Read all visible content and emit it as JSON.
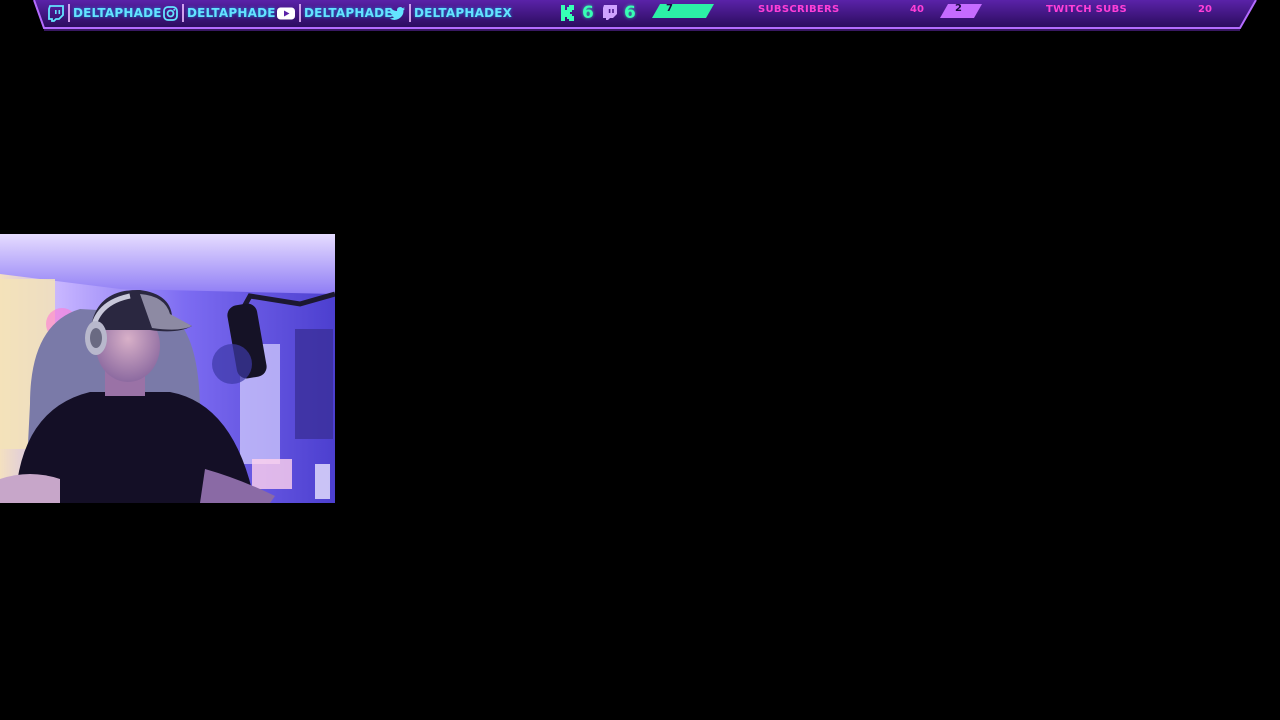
{
  "socials": [
    {
      "platform_icon": "twitch-icon",
      "handle": "DELTAPHADE"
    },
    {
      "platform_icon": "instagram-icon",
      "handle": "DELTAPHADE"
    },
    {
      "platform_icon": "youtube-icon",
      "handle": "DELTAPHADE"
    },
    {
      "platform_icon": "twitter-icon",
      "handle": "DELTAPHADEX"
    }
  ],
  "counters": {
    "kick": {
      "icon": "kick-icon",
      "value": "6"
    },
    "twitch": {
      "icon": "twitch-icon",
      "value": "6"
    }
  },
  "goals": [
    {
      "current": "7",
      "label": "SUBSCRIBERS",
      "target": "40"
    },
    {
      "current": "2",
      "label": "TWITCH SUBS",
      "target": "20"
    }
  ],
  "colors": {
    "bar_purple": "#4a1a8c",
    "handle_cyan": "#63e4ff",
    "counter_green": "#37ffb5",
    "goal_magenta": "#ff3fd8"
  }
}
